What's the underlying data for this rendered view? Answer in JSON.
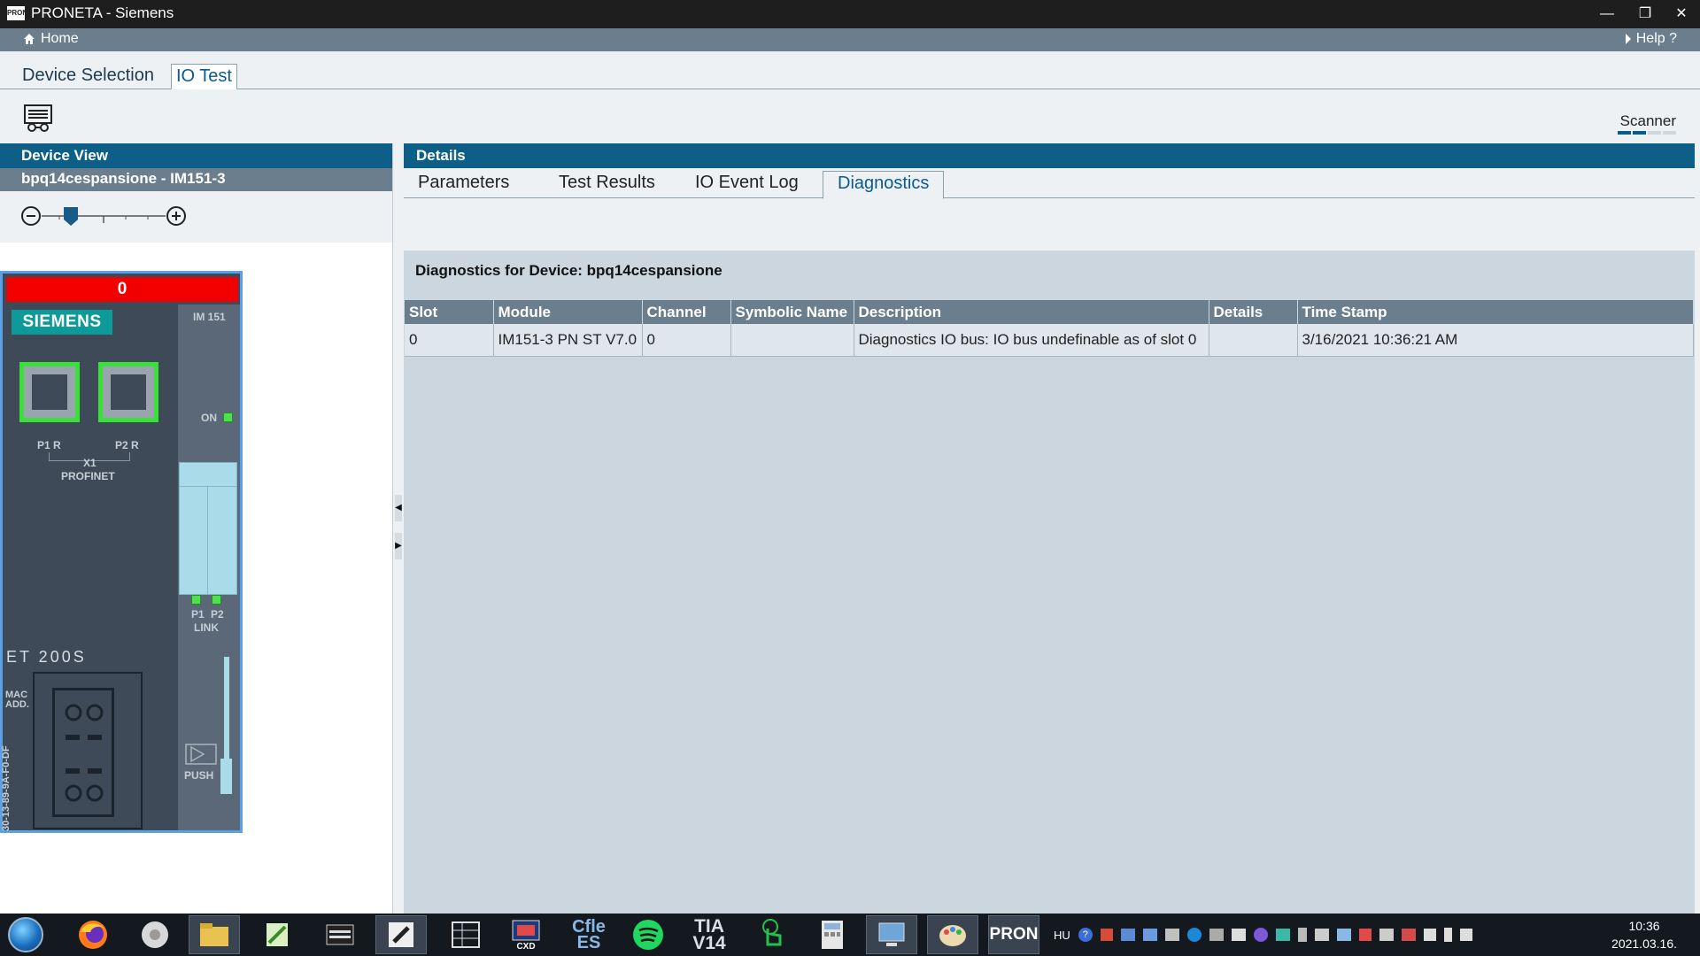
{
  "window": {
    "title": "PRONETA - Siemens",
    "icon_text": "PRON"
  },
  "nav": {
    "home": "Home",
    "help": "Help ?"
  },
  "main_tabs": [
    {
      "label": "Device Selection",
      "active": false
    },
    {
      "label": "IO Test",
      "active": true
    }
  ],
  "toolbar": {
    "scanner_label": "Scanner",
    "scanner_level": 2,
    "scanner_segments": 4
  },
  "device_view": {
    "header": "Device View",
    "device_name": "bpq14cespansione  -  IM151-3",
    "zoom_level_fraction": 0.22,
    "device": {
      "status": "0",
      "brand": "SIEMENS",
      "module": "IM 151",
      "on_label": "ON",
      "port1_label": "P1 R",
      "port2_label": "P2 R",
      "x1_label": "X1",
      "profinet_label": "PROFINET",
      "link_p1": "P1",
      "link_p2": "P2",
      "link_label": "LINK",
      "series": "ET 200S",
      "mac_label_1": "MAC",
      "mac_label_2": "ADD.",
      "mac_address": "30-13-89-9A-F0-DF",
      "push_label": "PUSH"
    }
  },
  "details": {
    "header": "Details",
    "tabs": [
      {
        "label": "Parameters",
        "active": false
      },
      {
        "label": "Test Results",
        "active": false
      },
      {
        "label": "IO Event Log",
        "active": false
      },
      {
        "label": "Diagnostics",
        "active": true
      }
    ],
    "diagnostics_title": "Diagnostics for Device: bpq14cespansione",
    "columns": [
      "Slot",
      "Module",
      "Channel",
      "Symbolic Name",
      "Description",
      "Details",
      "Time Stamp"
    ],
    "rows": [
      [
        "0",
        "IM151-3 PN ST V7.0",
        "0",
        "",
        "Diagnostics IO bus: IO bus undefinable as of slot  0",
        "",
        "3/16/2021 10:36:21 AM"
      ]
    ]
  },
  "taskbar": {
    "apps": [
      "firefox-icon",
      "chrome-icon",
      "file-explorer-icon",
      "notepad-icon",
      "terminal-icon",
      "active-app-icon",
      "grid-app-icon",
      "cxd-icon",
      "cfle-icon",
      "spotify-icon",
      "tia-icon",
      "touch-icon",
      "calculator-icon",
      "network-icon",
      "paint-icon",
      "proneta-icon"
    ],
    "tia_label": "TIA\nV14",
    "cfle_label": "Cfle\nES",
    "proneta_label": "PRON",
    "cxd_label": "CXD",
    "language": "HU",
    "time": "10:36",
    "date": "2021.03.16."
  },
  "colors": {
    "accent": "#0e5f87",
    "status_red": "#f20000",
    "port_green": "#38e038",
    "device_border": "#5aa0e6"
  }
}
